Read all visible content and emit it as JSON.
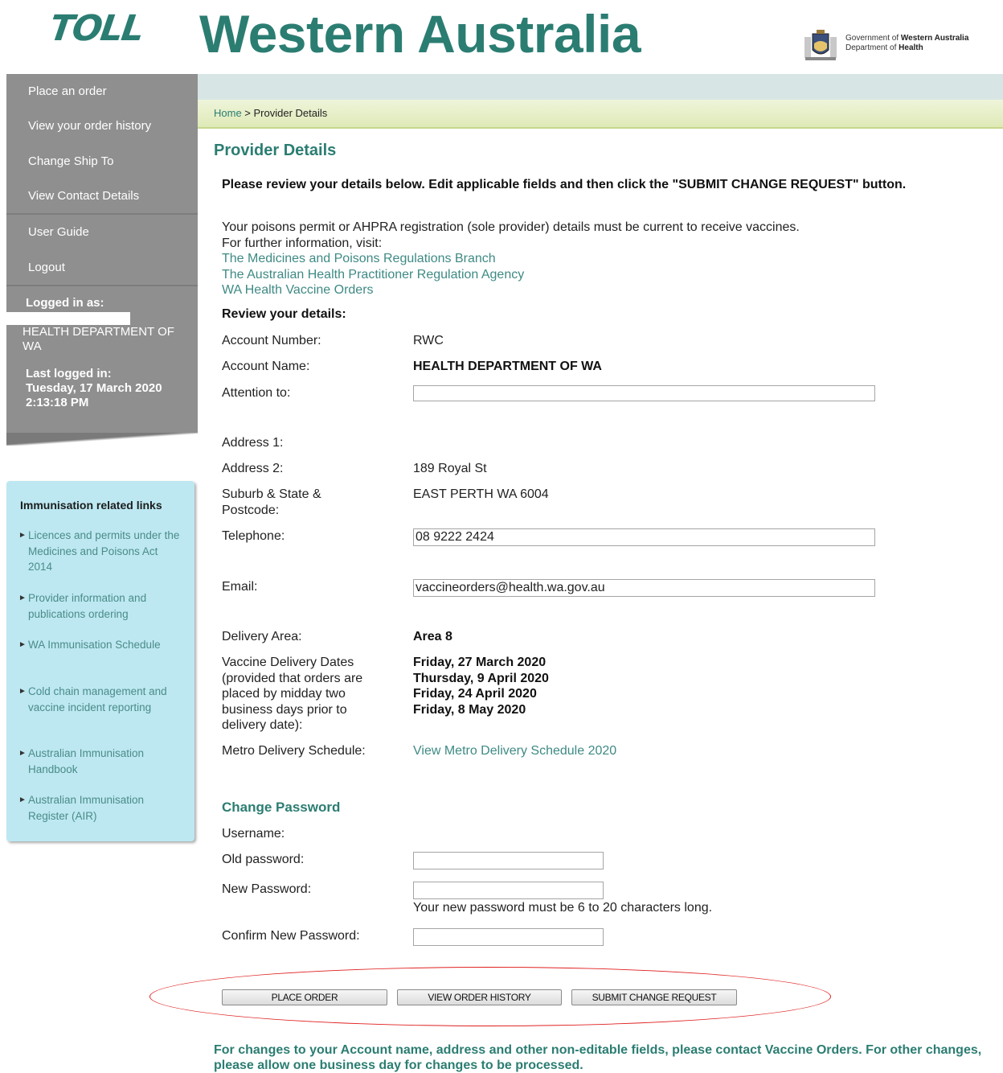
{
  "header": {
    "logo_text": "TOLL",
    "title": "Western Australia",
    "gov_line1_prefix": "Government of ",
    "gov_line1_bold": "Western Australia",
    "gov_line2_prefix": "Department of ",
    "gov_line2_bold": "Health"
  },
  "breadcrumb": {
    "home": "Home",
    "separator": " > ",
    "current": "Provider Details"
  },
  "sidebar": {
    "items": [
      {
        "label": "Place an order"
      },
      {
        "label": "View your order history"
      },
      {
        "label": "Change Ship To"
      },
      {
        "label": "View Contact Details"
      },
      {
        "label": "User Guide"
      },
      {
        "label": "Logout"
      }
    ],
    "logged_in_label": "Logged in as:",
    "logged_in_name": "HEALTH DEPARTMENT OF WA",
    "last_logged_label": "Last logged in:",
    "last_logged_value": "Tuesday, 17 March 2020 2:13:18 PM"
  },
  "links_box": {
    "title": "Immunisation related links",
    "items": [
      {
        "label": "Licences and permits under the Medicines and Poisons Act 2014"
      },
      {
        "label": "Provider information and publications ordering"
      },
      {
        "label": "WA Immunisation Schedule"
      },
      {
        "label": "Cold chain management and vaccine incident reporting"
      },
      {
        "label": "Australian Immunisation Handbook"
      },
      {
        "label": "Australian Immunisation Register (AIR)"
      }
    ]
  },
  "main": {
    "title": "Provider Details",
    "intro": "Please review your details below. Edit applicable fields and then click the \"SUBMIT CHANGE REQUEST\" button.",
    "info_line1": "Your poisons permit or AHPRA registration (sole provider) details must be current to receive vaccines.",
    "info_line2": "For further information, visit:",
    "info_links": [
      "The Medicines and Poisons Regulations Branch",
      "The Australian Health Practitioner Regulation Agency",
      "WA Health Vaccine Orders"
    ],
    "review_heading": "Review your details:",
    "fields": {
      "account_number_label": "Account Number:",
      "account_number_value": "RWC",
      "account_name_label": "Account Name:",
      "account_name_value": "HEALTH DEPARTMENT OF WA",
      "attention_label": "Attention to:",
      "attention_value": "",
      "address1_label": "Address 1:",
      "address1_value": "",
      "address2_label": "Address 2:",
      "address2_value": "189 Royal St",
      "suburb_label": "Suburb & State & Postcode:",
      "suburb_value": "EAST PERTH WA 6004",
      "telephone_label": "Telephone:",
      "telephone_value": "08 9222 2424",
      "email_label": "Email:",
      "email_value": "vaccineorders@health.wa.gov.au",
      "delivery_area_label": "Delivery Area:",
      "delivery_area_value": "Area 8",
      "delivery_dates_label": "Vaccine Delivery Dates (provided that orders are placed by midday two business days prior to delivery date):",
      "delivery_dates": [
        "Friday, 27 March 2020",
        "Thursday, 9 April 2020",
        "Friday, 24 April 2020",
        "Friday, 8 May 2020"
      ],
      "metro_label": "Metro Delivery Schedule:",
      "metro_link": "View Metro Delivery Schedule 2020"
    },
    "password": {
      "heading": "Change Password",
      "username_label": "Username:",
      "old_label": "Old password:",
      "new_label": "New Password:",
      "new_hint": "Your new password must be 6 to 20 characters long.",
      "confirm_label": "Confirm New Password:"
    },
    "buttons": {
      "place_order": "PLACE ORDER",
      "view_history": "VIEW ORDER HISTORY",
      "submit_change": "SUBMIT CHANGE REQUEST"
    },
    "footer_note": "For changes to your Account name, address and other non-editable fields, please contact Vaccine Orders. For other changes, please allow one business day for changes to be processed."
  },
  "colors": {
    "brand": "#2b7d72",
    "sidebar": "#8f8f8f",
    "links_box": "#bde8f2",
    "annotation": "#e02020"
  }
}
